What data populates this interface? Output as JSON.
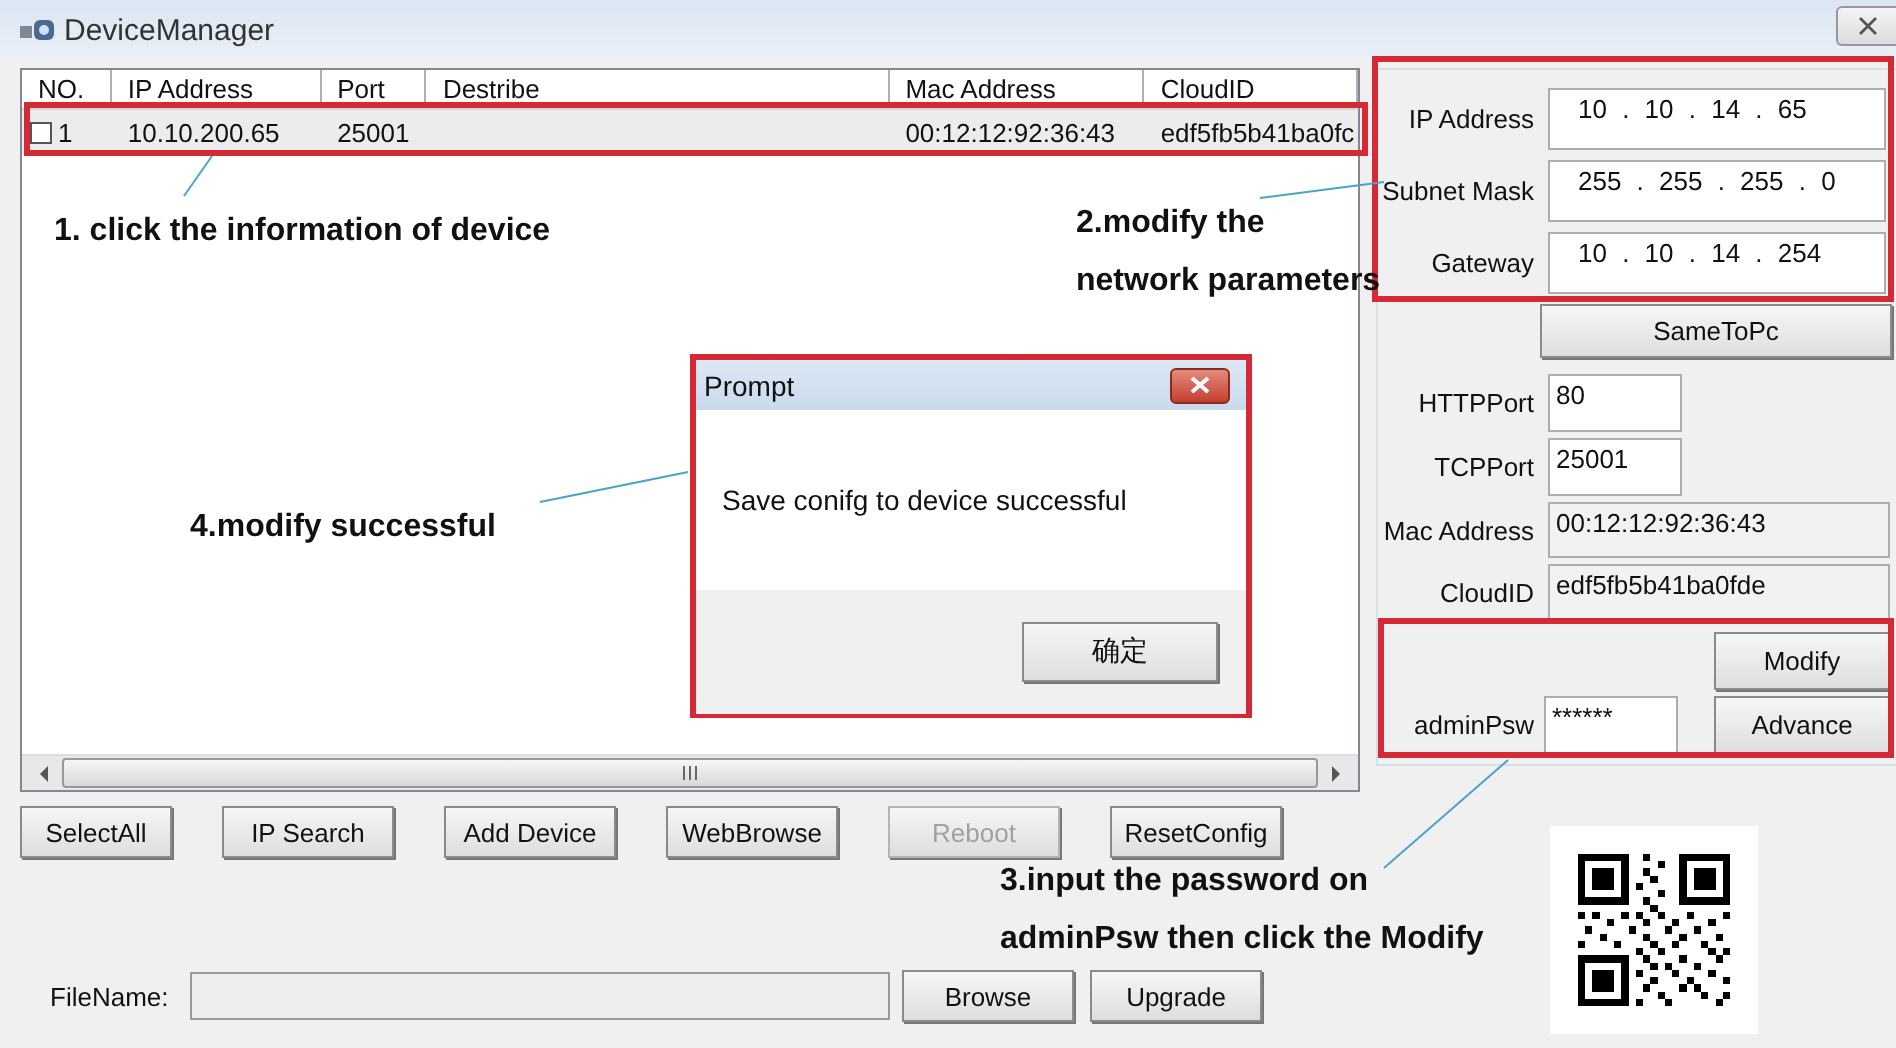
{
  "window": {
    "title": "DeviceManager"
  },
  "device_list": {
    "columns": [
      "NO.",
      "IP Address",
      "Port",
      "Destribe",
      "Mac Address",
      "CloudID"
    ],
    "rows": [
      {
        "checked": false,
        "selected": true,
        "cells": [
          "1",
          "10.10.200.65",
          "25001",
          null,
          "00:12:12:92:36:43",
          "edf5fb5b41ba0fc"
        ]
      }
    ]
  },
  "network": {
    "fields": [
      {
        "label": "IP Address",
        "value": "10 . 10 . 14 . 65"
      },
      {
        "label": "Subnet Mask",
        "value": "255 . 255 . 255 . 0"
      },
      {
        "label": "Gateway",
        "value": "10 . 10 . 14 . 254"
      }
    ],
    "button": "SameToPc"
  },
  "details": [
    {
      "label": "HTTPPort",
      "value": "80",
      "kind": "editable"
    },
    {
      "label": "TCPPort",
      "value": "25001",
      "kind": "editable"
    },
    {
      "label": "Mac Address",
      "value": "00:12:12:92:36:43",
      "kind": "readonly"
    },
    {
      "label": "CloudID",
      "value": "edf5fb5b41ba0fde",
      "kind": "readonly"
    }
  ],
  "admin": {
    "label": "adminPsw",
    "value": "******",
    "buttons": [
      "Modify",
      "Advance"
    ]
  },
  "actions": [
    {
      "label": "SelectAll",
      "disabled": false
    },
    {
      "label": "IP Search",
      "disabled": false
    },
    {
      "label": "Add Device",
      "disabled": false
    },
    {
      "label": "WebBrowse",
      "disabled": false
    },
    {
      "label": "Reboot",
      "disabled": true
    },
    {
      "label": "ResetConfig",
      "disabled": false
    }
  ],
  "file": {
    "label": "FileName:",
    "buttons": [
      "Browse",
      "Upgrade"
    ]
  },
  "dialog": {
    "title": "Prompt",
    "message": "Save conifg to device successful",
    "button": "确定"
  },
  "annotations": [
    {
      "lines": [
        "1. click the information of device"
      ]
    },
    {
      "lines": [
        "2.modify the",
        "network parameters"
      ]
    },
    {
      "lines": [
        "3.input the password on",
        "adminPsw then click the Modify"
      ]
    },
    {
      "lines": [
        "4.modify successful"
      ]
    }
  ]
}
